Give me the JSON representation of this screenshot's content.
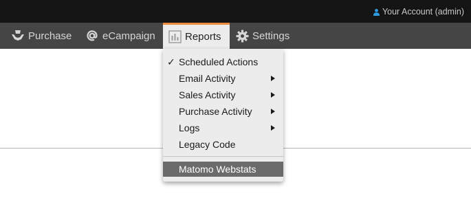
{
  "topbar": {
    "account_label": "Your Account (admin)",
    "account_icon": "user-icon",
    "account_icon_color": "#2e9be0"
  },
  "nav": {
    "items": [
      {
        "label": "Purchase",
        "icon": "purchase-hands-icon"
      },
      {
        "label": "eCampaign",
        "icon": "at-sign-icon"
      },
      {
        "label": "Reports",
        "icon": "bar-chart-icon",
        "active": true
      },
      {
        "label": "Settings",
        "icon": "gear-icon"
      }
    ],
    "active_accent": "#ee8c3d"
  },
  "reports_menu": {
    "items": [
      {
        "label": "Scheduled Actions",
        "checked": true,
        "check_mark": "✓"
      },
      {
        "label": "Email Activity",
        "has_submenu": true
      },
      {
        "label": "Sales Activity",
        "has_submenu": true
      },
      {
        "label": "Purchase Activity",
        "has_submenu": true
      },
      {
        "label": "Logs",
        "has_submenu": true
      },
      {
        "label": "Legacy Code"
      },
      {
        "label": "Matomo Webstats",
        "highlighted": true
      }
    ]
  }
}
